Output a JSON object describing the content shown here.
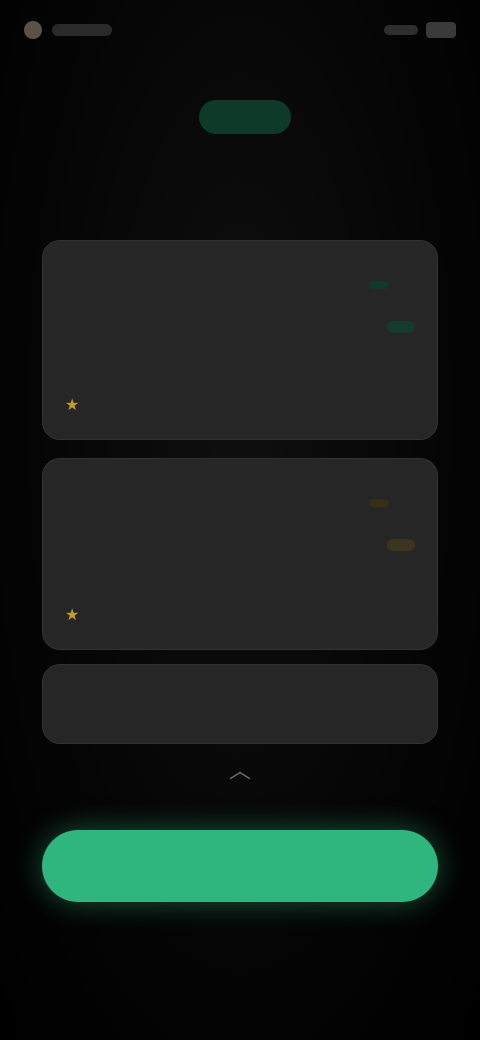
{
  "status_bar": {
    "time": "",
    "battery": ""
  },
  "header": {
    "title": "",
    "title_highlight": "",
    "subtitle": ""
  },
  "plans": [
    {
      "name": "",
      "sub": "",
      "price": "",
      "badge": "",
      "feature": ""
    },
    {
      "name": "",
      "sub": "",
      "price": "",
      "badge": "",
      "feature": ""
    },
    {
      "name": "",
      "price": ""
    }
  ],
  "more": {
    "label": ""
  },
  "cta": {
    "label": ""
  },
  "restore": {
    "label": ""
  },
  "legal": {
    "text": ""
  },
  "colors": {
    "accent_green": "#2fb57e",
    "highlight_green": "#34d399",
    "gold": "#f2c14e",
    "card_bg": "#262626",
    "background": "#000000"
  },
  "icons": [
    "status-indicator-icon",
    "signal-icon",
    "battery-icon",
    "star-icon",
    "chevron-up-icon"
  ]
}
